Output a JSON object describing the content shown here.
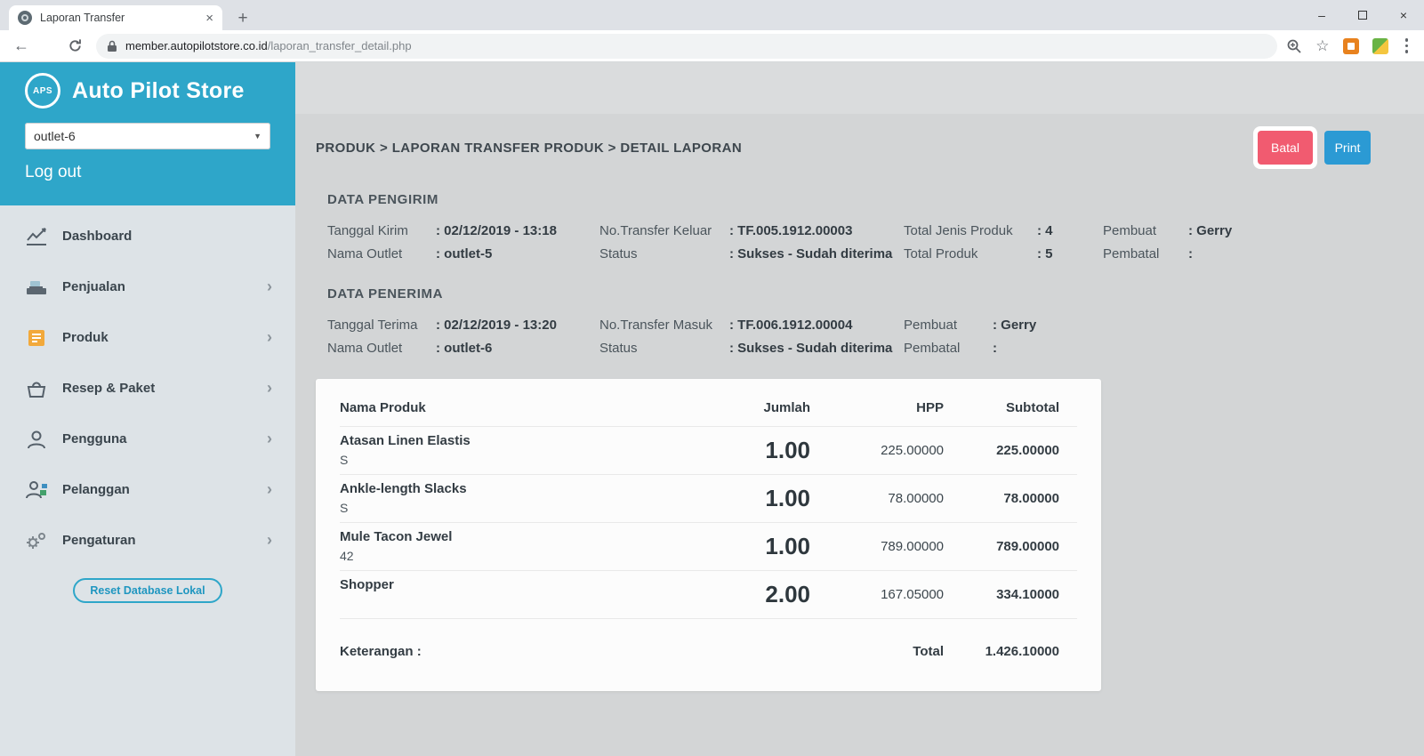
{
  "browser": {
    "tab_title": "Laporan Transfer",
    "new_tab": "+",
    "url_host": "member.autopilotstore.co.id",
    "url_path": "/laporan_transfer_detail.php"
  },
  "sidebar": {
    "logo_text": "APS",
    "brand": "Auto Pilot Store",
    "outlet_selected": "outlet-6",
    "logout_label": "Log out",
    "menu": [
      {
        "label": "Dashboard",
        "icon": "dashboard-icon"
      },
      {
        "label": "Penjualan",
        "icon": "sales-icon"
      },
      {
        "label": "Produk",
        "icon": "product-icon"
      },
      {
        "label": "Resep & Paket",
        "icon": "recipe-icon"
      },
      {
        "label": "Pengguna",
        "icon": "user-icon"
      },
      {
        "label": "Pelanggan",
        "icon": "customer-icon"
      },
      {
        "label": "Pengaturan",
        "icon": "settings-icon"
      }
    ],
    "reset_button_label": "Reset Database Lokal"
  },
  "main": {
    "breadcrumb": "PRODUK > LAPORAN TRANSFER PRODUK > DETAIL LAPORAN",
    "batal_button": "Batal",
    "print_button": "Print",
    "pengirim": {
      "title": "DATA PENGIRIM",
      "rows": [
        [
          {
            "label": "Tanggal Kirim",
            "value": ": 02/12/2019 - 13:18"
          },
          {
            "label": "No.Transfer Keluar",
            "value": ": TF.005.1912.00003"
          },
          {
            "label": "Total Jenis Produk",
            "value": ": 4"
          },
          {
            "label": "Pembuat",
            "value": ": Gerry"
          }
        ],
        [
          {
            "label": "Nama Outlet",
            "value": ": outlet-5"
          },
          {
            "label": "Status",
            "value": ": Sukses - Sudah diterima"
          },
          {
            "label": "Total Produk",
            "value": ": 5"
          },
          {
            "label": "Pembatal",
            "value": ":"
          }
        ]
      ]
    },
    "penerima": {
      "title": "DATA PENERIMA",
      "rows": [
        [
          {
            "label": "Tanggal Terima",
            "value": ": 02/12/2019 - 13:20"
          },
          {
            "label": "No.Transfer Masuk",
            "value": ": TF.006.1912.00004"
          },
          {
            "label": "Pembuat",
            "value": ": Gerry"
          }
        ],
        [
          {
            "label": "Nama Outlet",
            "value": ": outlet-6"
          },
          {
            "label": "Status",
            "value": ": Sukses - Sudah diterima"
          },
          {
            "label": "Pembatal",
            "value": ":"
          }
        ]
      ]
    },
    "table": {
      "headers": [
        "Nama Produk",
        "Jumlah",
        "HPP",
        "Subtotal"
      ],
      "rows": [
        {
          "name": "Atasan Linen Elastis",
          "variant": "S",
          "qty": "1.00",
          "hpp": "225.00000",
          "subtotal": "225.00000"
        },
        {
          "name": "Ankle-length Slacks",
          "variant": "S",
          "qty": "1.00",
          "hpp": "78.00000",
          "subtotal": "78.00000"
        },
        {
          "name": "Mule Tacon Jewel",
          "variant": "42",
          "qty": "1.00",
          "hpp": "789.00000",
          "subtotal": "789.00000"
        },
        {
          "name": "Shopper",
          "variant": "",
          "qty": "2.00",
          "hpp": "167.05000",
          "subtotal": "334.10000"
        }
      ],
      "keterangan_label": "Keterangan :",
      "total_label": "Total",
      "total_value": "1.426.10000"
    }
  },
  "colors": {
    "accent": "#2ea6c9",
    "batal": "#f15b70",
    "print": "#2b9ad4"
  }
}
